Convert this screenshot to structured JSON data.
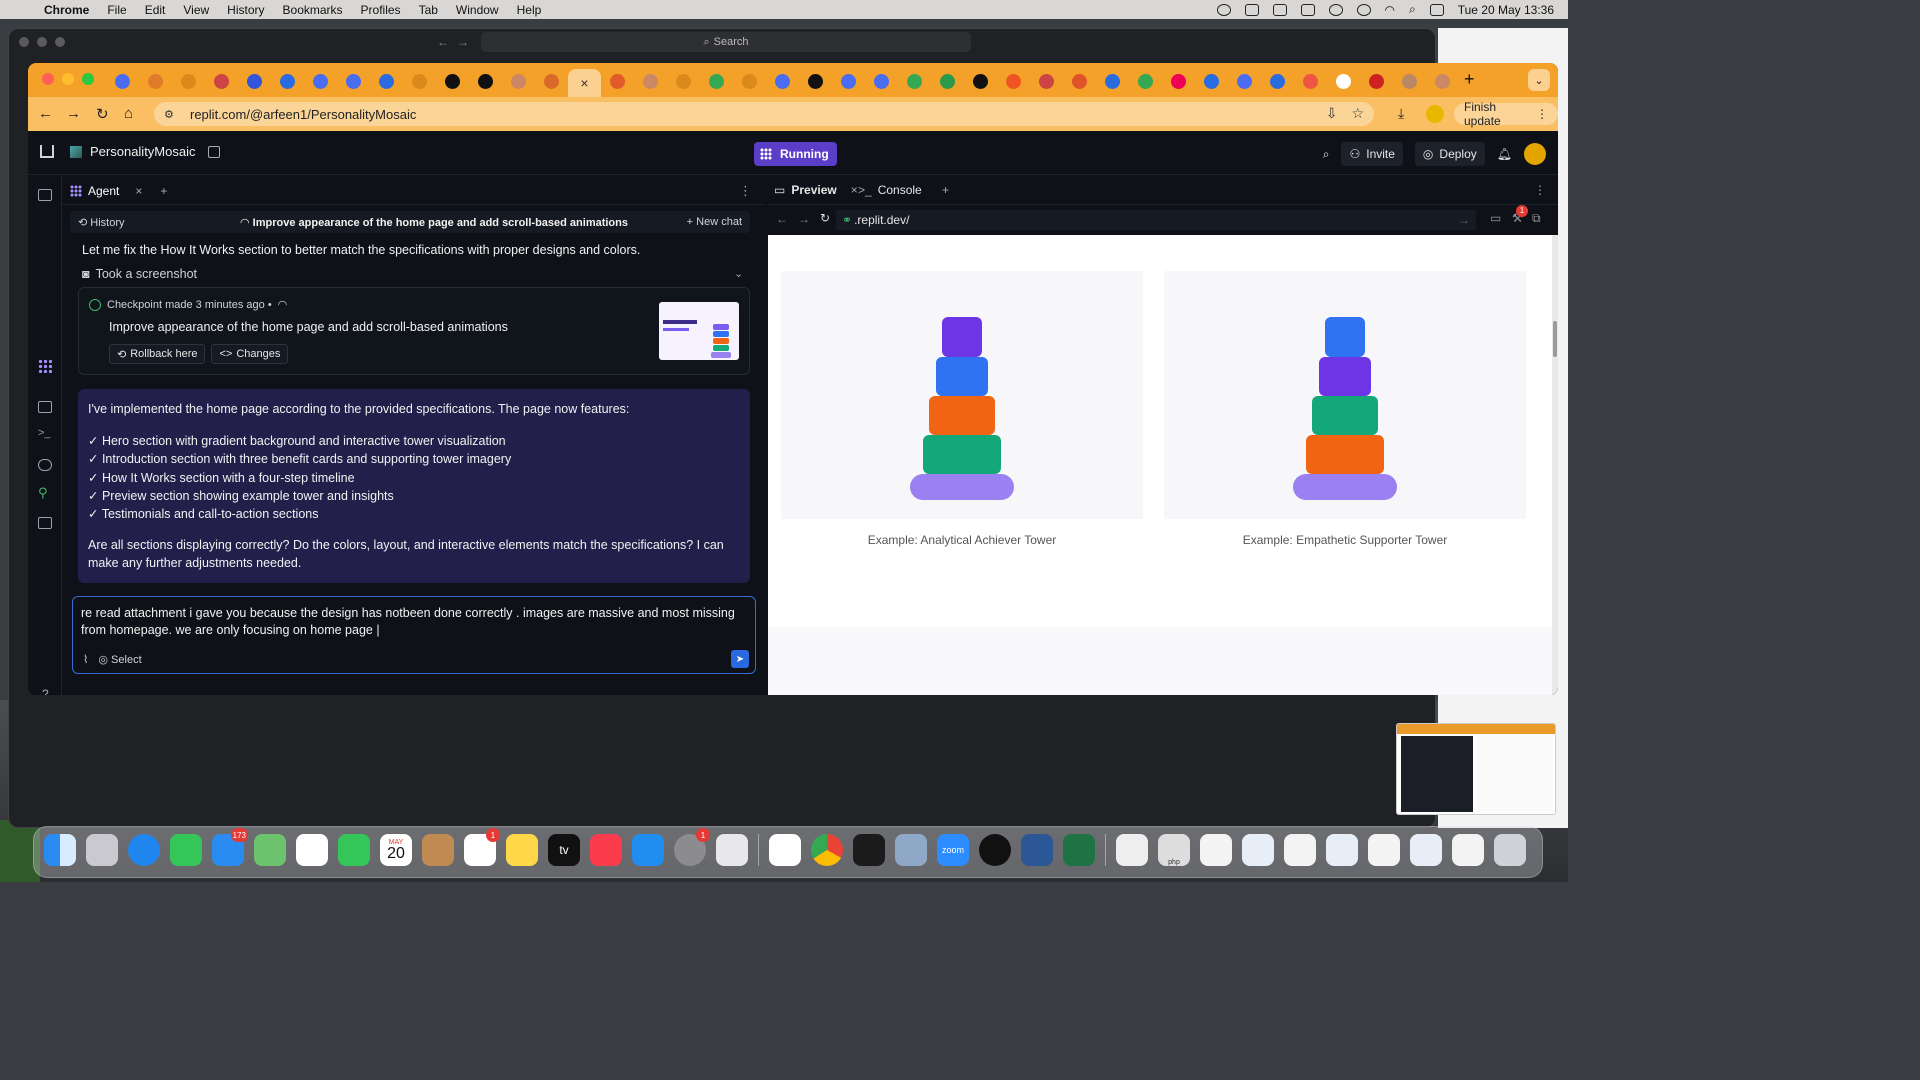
{
  "menubar": {
    "app": "Chrome",
    "items": [
      "File",
      "Edit",
      "View",
      "History",
      "Bookmarks",
      "Profiles",
      "Tab",
      "Window",
      "Help"
    ],
    "clock": "Tue 20 May  13:36"
  },
  "back_window": {
    "search_label": "Search"
  },
  "browser": {
    "url": "replit.com/@arfeen1/PersonalityMosaic",
    "finish_update": "Finish update"
  },
  "replit": {
    "project_name": "PersonalityMosaic",
    "run_status": "Running",
    "invite_label": "Invite",
    "deploy_label": "Deploy"
  },
  "agent": {
    "tab_label": "Agent",
    "history_label": "History",
    "chat_title": "Improve appearance of the home page and add scroll-based animations",
    "new_chat_label": "New chat",
    "message_intro": "Let me fix the How It Works section to better match the specifications with proper designs and colors.",
    "screenshot_label": "Took a screenshot",
    "checkpoint": {
      "meta": "Checkpoint made 3 minutes ago •",
      "title": "Improve appearance of the home page and add scroll-based animations",
      "rollback_label": "Rollback here",
      "changes_label": "Changes"
    },
    "reply": {
      "intro": "I've implemented the home page according to the provided specifications. The page now features:",
      "bullets": [
        "✓ Hero section with gradient background and interactive tower visualization",
        "✓ Introduction section with three benefit cards and supporting tower imagery",
        "✓ How It Works section with a four-step timeline",
        "✓ Preview section showing example tower and insights",
        "✓ Testimonials and call-to-action sections"
      ],
      "question": "Are all sections displaying correctly? Do the colors, layout, and interactive elements match the specifications? I can make any further adjustments needed."
    },
    "input_text": "re read attachment i gave you because the design has notbeen done correctly . images are massive and most missing from homepage. we are only focusing on home page |",
    "select_label": "Select",
    "help_label": "?"
  },
  "preview": {
    "tab_preview": "Preview",
    "tab_console": "Console",
    "url": ".replit.dev/",
    "notif_count": "1",
    "cards": [
      {
        "label": "Example: Analytical Achiever Tower"
      },
      {
        "label": "Example: Empathetic Supporter Tower"
      }
    ]
  },
  "colors": {
    "purple": "#6d35e6",
    "blue": "#2f73f2",
    "orange": "#f06414",
    "green": "#14a878",
    "lavender": "#9a80f0",
    "replit_running": "#5b3ec8",
    "browser_tabbar": "#f4a12a"
  },
  "dock": {
    "mail_badge": "173",
    "reminders_badge": "1",
    "settings_badge": "1",
    "calendar_month": "MAY",
    "calendar_day": "20",
    "tv_label": "tv",
    "zoom_label": "zoom",
    "php_label": "php"
  }
}
